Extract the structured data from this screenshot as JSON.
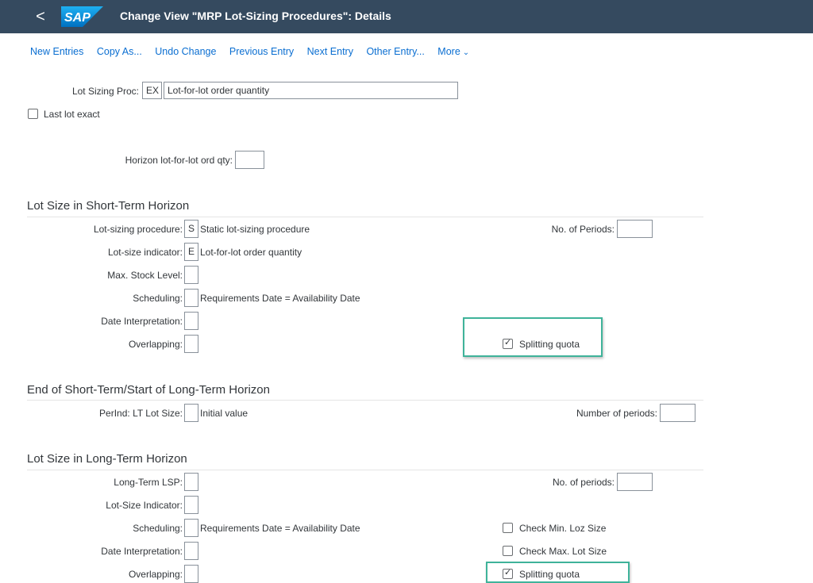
{
  "header": {
    "back_glyph": "<",
    "logo_text": "SAP",
    "title": "Change View \"MRP Lot-Sizing Procedures\": Details",
    "accent": "#354a5f"
  },
  "toolbar": {
    "new_entries": "New Entries",
    "copy_as": "Copy As...",
    "undo_change": "Undo Change",
    "previous_entry": "Previous Entry",
    "next_entry": "Next Entry",
    "other_entry": "Other Entry...",
    "more": "More",
    "link_color": "#0a6ed1"
  },
  "top": {
    "lot_sizing_proc_label": "Lot Sizing Proc:",
    "lot_sizing_proc_code": "EX",
    "lot_sizing_proc_desc": "Lot-for-lot order quantity",
    "last_lot_exact_label": "Last lot exact",
    "horizon_label": "Horizon  lot-for-lot ord qty:"
  },
  "short_term": {
    "title": "Lot Size in Short-Term Horizon",
    "lot_sizing_procedure_label": "Lot-sizing procedure:",
    "lot_sizing_procedure_code": "S",
    "lot_sizing_procedure_desc": "Static lot-sizing procedure",
    "lot_size_indicator_label": "Lot-size indicator:",
    "lot_size_indicator_code": "E",
    "lot_size_indicator_desc": "Lot-for-lot order quantity",
    "max_stock_level_label": "Max. Stock Level:",
    "scheduling_label": "Scheduling:",
    "scheduling_desc": "Requirements Date = Availability Date",
    "date_interpretation_label": "Date Interpretation:",
    "overlapping_label": "Overlapping:",
    "no_of_periods_label": "No. of Periods:",
    "splitting_quota_label": "Splitting quota"
  },
  "transition": {
    "title": "End of Short-Term/Start of Long-Term Horizon",
    "perind_label": "PerInd: LT Lot Size:",
    "perind_desc": "Initial value",
    "number_of_periods_label": "Number of periods:"
  },
  "long_term": {
    "title": "Lot Size in Long-Term Horizon",
    "long_term_lsp_label": "Long-Term LSP:",
    "lot_size_indicator_label": "Lot-Size Indicator:",
    "scheduling_label": "Scheduling:",
    "scheduling_desc": "Requirements Date = Availability Date",
    "date_interpretation_label": "Date Interpretation:",
    "overlapping_label": "Overlapping:",
    "no_of_periods_label": "No. of periods:",
    "check_min_label": "Check Min. Loz Size",
    "check_max_label": "Check Max. Lot Size",
    "splitting_quota_label": "Splitting quota"
  },
  "highlight_color": "#3fb39a"
}
